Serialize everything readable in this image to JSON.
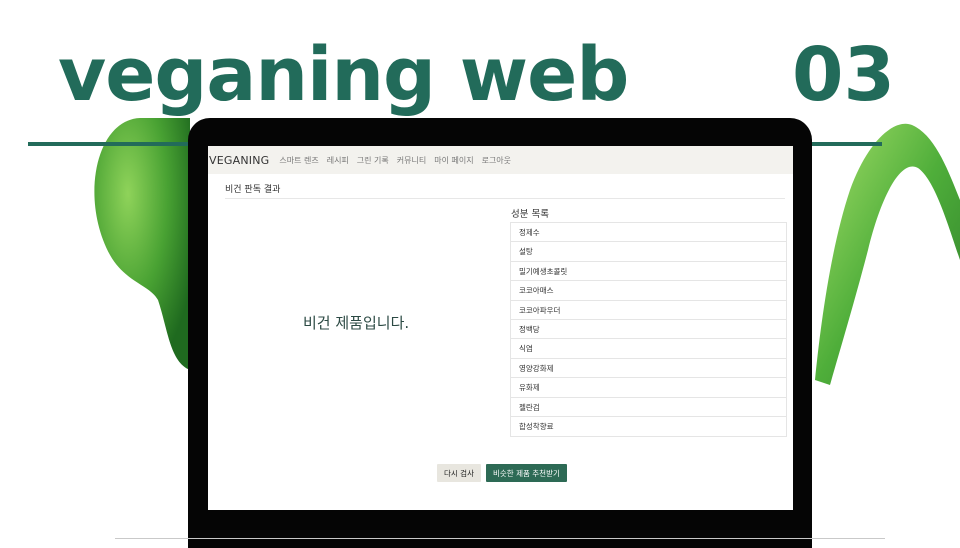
{
  "hero": {
    "title": "veganing web",
    "number": "03"
  },
  "colors": {
    "brand_green": "#226b5a",
    "button_green": "#2d6a55",
    "nav_bg": "#f3f2ee"
  },
  "app": {
    "brand": "VEGANING",
    "nav": [
      "스마트 렌즈",
      "레시피",
      "그린 기록",
      "커뮤니티",
      "마이 페이지",
      "로그아웃"
    ],
    "result_title": "비건 판독 결과",
    "verdict": "비건 제품입니다.",
    "ingredients_title": "성분 목록",
    "ingredients": [
      "정제수",
      "설탕",
      "밀기예생초콜릿",
      "코코아매스",
      "코코아파우더",
      "정백당",
      "식염",
      "영양강화제",
      "유화제",
      "젤란검",
      "합성착향료"
    ],
    "buttons": {
      "retry": "다시 검사",
      "recommend": "비슷한 제품 추천받기"
    }
  }
}
